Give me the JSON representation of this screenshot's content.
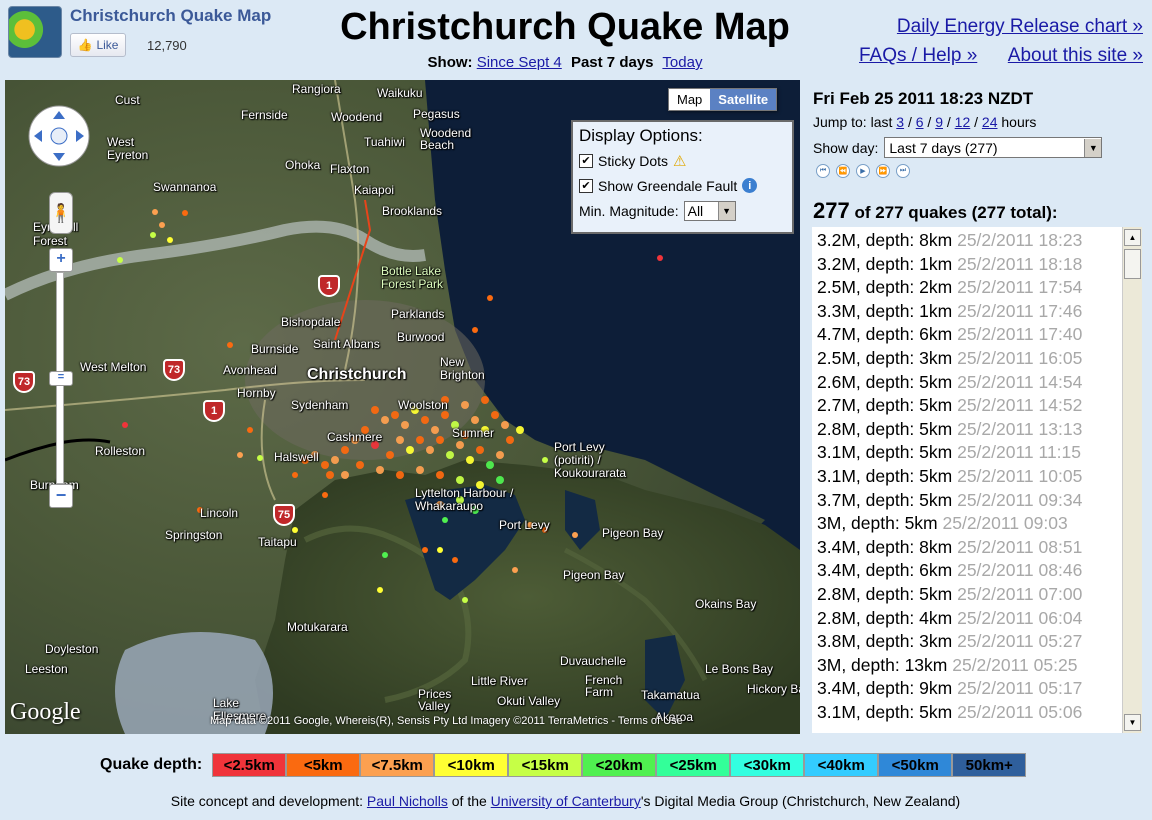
{
  "header": {
    "site_name": "Christchurch Quake Map",
    "like_label": "Like",
    "like_count": "12,790",
    "title": "Christchurch Quake Map",
    "show_label": "Show:",
    "show_options": [
      "Since Sept 4",
      "Past 7 days",
      "Today"
    ],
    "link_energy": "Daily Energy Release chart »",
    "link_faq": "FAQs / Help »",
    "link_about": "About this site »"
  },
  "map": {
    "type_map": "Map",
    "type_satellite": "Satellite",
    "display_options": {
      "title": "Display Options:",
      "sticky_dots": "Sticky Dots",
      "show_fault": "Show Greendale Fault",
      "min_mag_label": "Min. Magnitude:",
      "min_mag_value": "All"
    },
    "places": [
      "Rangiora",
      "Waikuku",
      "Cust",
      "Fernside",
      "Woodend",
      "Pegasus",
      "Tuahiwi",
      "Woodend Beach",
      "West Eyreton",
      "Ohoka",
      "Flaxton",
      "Kaiapoi",
      "Swannanoa",
      "Brooklands",
      "Eyrewell Forest",
      "Bottle Lake Forest Park",
      "Parklands",
      "Bishopdale",
      "Burwood",
      "Burnside",
      "Saint Albans",
      "New Brighton",
      "West Melton",
      "Avonhead",
      "Christchurch",
      "Hornby",
      "Sydenham",
      "Woolston",
      "Cashmere",
      "Sumner",
      "Port Levy (potiriti) / Koukourarata",
      "Rolleston",
      "Halswell",
      "Lyttelton Harbour / Whakaraupo",
      "Burnham",
      "Lincoln",
      "Port Levy",
      "Pigeon Bay",
      "Springston",
      "Taitapu",
      "Pigeon Bay",
      "Okains Bay",
      "Motukarara",
      "Doyleston",
      "Duvauchelle",
      "Leeston",
      "Little River",
      "French Farm",
      "Le Bons Bay",
      "Takamatua",
      "Akaroa",
      "Hickory Bay",
      "Prices Valley",
      "Okuti Valley",
      "Lake Ellesmere"
    ],
    "route_shields": [
      "1",
      "73",
      "73",
      "1",
      "75"
    ],
    "google_logo": "Google",
    "attribution": "Map data ©2011 Google, Whereis(R), Sensis Pty Ltd Imagery ©2011 TerraMetrics - Terms of Use"
  },
  "panel": {
    "datetime": "Fri Feb 25 2011 18:23 NZDT",
    "jump_label": "Jump to: last",
    "jump_options": [
      "3",
      "6",
      "9",
      "12",
      "24"
    ],
    "jump_suffix": "hours",
    "show_day_label": "Show day:",
    "show_day_value": "Last 7 days (277)",
    "count_shown": "277",
    "count_text": "of 277 quakes (277 total):",
    "quakes": [
      {
        "mag": "3.2M",
        "depth": "8km",
        "time": "25/2/2011 18:23"
      },
      {
        "mag": "3.2M",
        "depth": "1km",
        "time": "25/2/2011 18:18"
      },
      {
        "mag": "2.5M",
        "depth": "2km",
        "time": "25/2/2011 17:54"
      },
      {
        "mag": "3.3M",
        "depth": "1km",
        "time": "25/2/2011 17:46"
      },
      {
        "mag": "4.7M",
        "depth": "6km",
        "time": "25/2/2011 17:40"
      },
      {
        "mag": "2.5M",
        "depth": "3km",
        "time": "25/2/2011 16:05"
      },
      {
        "mag": "2.6M",
        "depth": "5km",
        "time": "25/2/2011 14:54"
      },
      {
        "mag": "2.7M",
        "depth": "5km",
        "time": "25/2/2011 14:52"
      },
      {
        "mag": "2.8M",
        "depth": "5km",
        "time": "25/2/2011 13:13"
      },
      {
        "mag": "3.1M",
        "depth": "5km",
        "time": "25/2/2011 11:15"
      },
      {
        "mag": "3.1M",
        "depth": "5km",
        "time": "25/2/2011 10:05"
      },
      {
        "mag": "3.7M",
        "depth": "5km",
        "time": "25/2/2011 09:34"
      },
      {
        "mag": "3M",
        "depth": "5km",
        "time": "25/2/2011 09:03"
      },
      {
        "mag": "3.4M",
        "depth": "8km",
        "time": "25/2/2011 08:51"
      },
      {
        "mag": "3.4M",
        "depth": "6km",
        "time": "25/2/2011 08:46"
      },
      {
        "mag": "2.8M",
        "depth": "5km",
        "time": "25/2/2011 07:00"
      },
      {
        "mag": "2.8M",
        "depth": "4km",
        "time": "25/2/2011 06:04"
      },
      {
        "mag": "3.8M",
        "depth": "3km",
        "time": "25/2/2011 05:27"
      },
      {
        "mag": "3M",
        "depth": "13km",
        "time": "25/2/2011 05:25"
      },
      {
        "mag": "3.4M",
        "depth": "9km",
        "time": "25/2/2011 05:17"
      },
      {
        "mag": "3.1M",
        "depth": "5km",
        "time": "25/2/2011 05:06"
      }
    ]
  },
  "legend": {
    "label": "Quake depth:",
    "items": [
      {
        "label": "<2.5km",
        "color": "#f0343a"
      },
      {
        "label": "<5km",
        "color": "#fa6a10"
      },
      {
        "label": "<7.5km",
        "color": "#fca050"
      },
      {
        "label": "<10km",
        "color": "#ffff33"
      },
      {
        "label": "<15km",
        "color": "#c6ff46"
      },
      {
        "label": "<20km",
        "color": "#50f050"
      },
      {
        "label": "<25km",
        "color": "#33ff99"
      },
      {
        "label": "<30km",
        "color": "#33ffe0"
      },
      {
        "label": "<40km",
        "color": "#33ccff"
      },
      {
        "label": "<50km",
        "color": "#2f88d8"
      },
      {
        "label": "50km+",
        "color": "#2f5f9c"
      }
    ]
  },
  "footer": {
    "prefix": "Site concept and development:",
    "author": "Paul Nicholls",
    "mid": "of the",
    "university": "University of Canterbury",
    "suffix": "'s Digital Media Group (Christchurch, New Zealand)"
  }
}
